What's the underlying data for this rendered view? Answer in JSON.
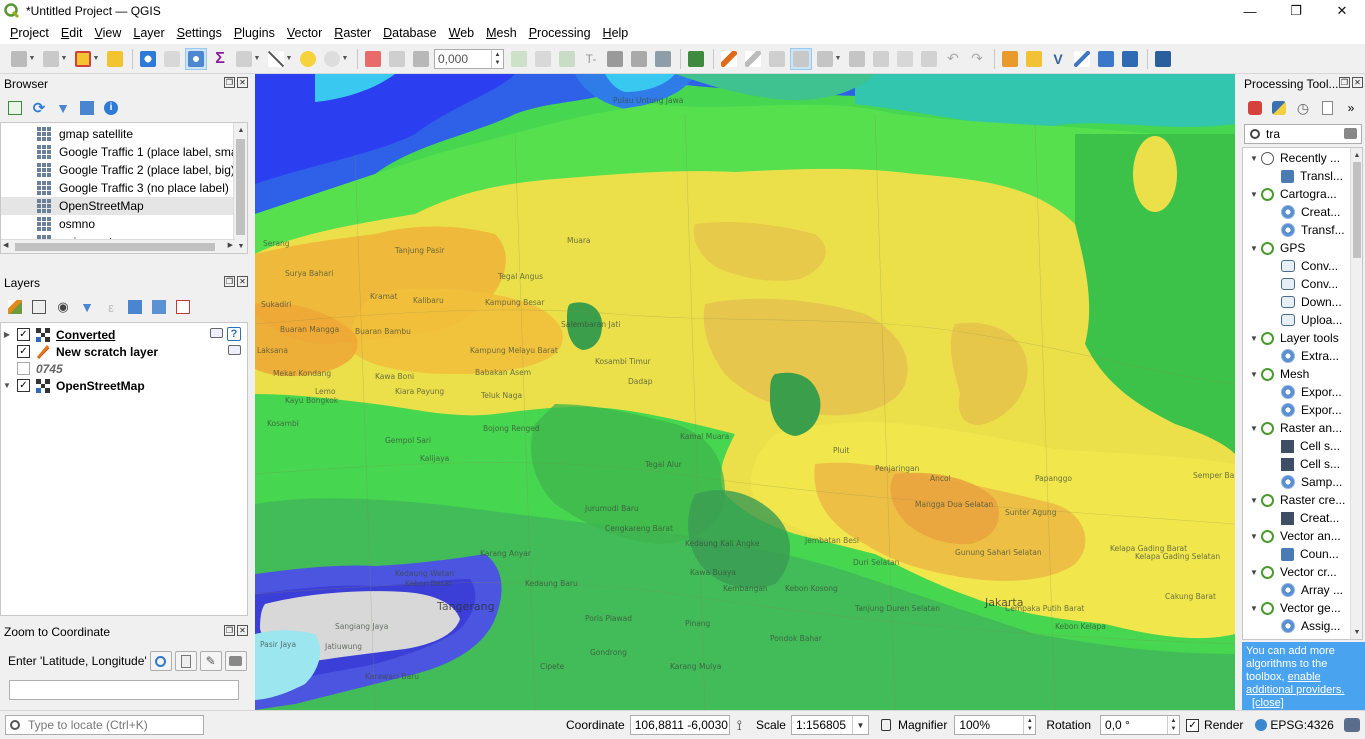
{
  "window": {
    "title": "*Untitled Project — QGIS",
    "minimize": "—",
    "restore": "❐",
    "close": "✕"
  },
  "menu": [
    "Project",
    "Edit",
    "View",
    "Layer",
    "Settings",
    "Plugins",
    "Vector",
    "Raster",
    "Database",
    "Web",
    "Mesh",
    "Processing",
    "Help"
  ],
  "toolbar": {
    "rotation_value": "0,000"
  },
  "browser": {
    "title": "Browser",
    "items": [
      {
        "label": "gmap satellite",
        "selected": false
      },
      {
        "label": "Google Traffic 1 (place label, smal",
        "selected": false
      },
      {
        "label": "Google Traffic 2 (place label, big)",
        "selected": false
      },
      {
        "label": "Google Traffic 3 (no place label)",
        "selected": false
      },
      {
        "label": "OpenStreetMap",
        "selected": true
      },
      {
        "label": "osmno",
        "selected": false
      },
      {
        "label": "swiss-carto",
        "selected": false
      }
    ]
  },
  "layers": {
    "title": "Layers",
    "items": [
      {
        "label": "Converted",
        "checked": true,
        "expanded": false
      },
      {
        "label": "New scratch layer",
        "checked": true,
        "expanded": false
      },
      {
        "label": "0745",
        "checked": false,
        "expanded": false
      },
      {
        "label": "OpenStreetMap",
        "checked": true,
        "expanded": true
      }
    ]
  },
  "zoom": {
    "title": "Zoom to Coordinate",
    "label": "Enter 'Latitude, Longitude'",
    "value": ""
  },
  "processing": {
    "title": "Processing Tool...",
    "search_value": "tra",
    "tree": [
      {
        "level": 0,
        "icon": "clock-icon",
        "label": "Recently ..."
      },
      {
        "level": 1,
        "icon": "script-icon",
        "label": "Transl..."
      },
      {
        "level": 0,
        "icon": "qgis-icon",
        "label": "Cartogra..."
      },
      {
        "level": 1,
        "icon": "gear-icon",
        "label": "Creat..."
      },
      {
        "level": 1,
        "icon": "gear-icon",
        "label": "Transf..."
      },
      {
        "level": 0,
        "icon": "qgis-icon",
        "label": "GPS"
      },
      {
        "level": 1,
        "icon": "convert-icon",
        "label": "Conv..."
      },
      {
        "level": 1,
        "icon": "convert-icon",
        "label": "Conv..."
      },
      {
        "level": 1,
        "icon": "convert-icon",
        "label": "Down..."
      },
      {
        "level": 1,
        "icon": "convert-icon",
        "label": "Uploa..."
      },
      {
        "level": 0,
        "icon": "qgis-icon",
        "label": "Layer tools"
      },
      {
        "level": 1,
        "icon": "gear-icon",
        "label": "Extra..."
      },
      {
        "level": 0,
        "icon": "qgis-icon",
        "label": "Mesh"
      },
      {
        "level": 1,
        "icon": "gear-icon",
        "label": "Expor..."
      },
      {
        "level": 1,
        "icon": "gear-icon",
        "label": "Expor..."
      },
      {
        "level": 0,
        "icon": "qgis-icon",
        "label": "Raster an..."
      },
      {
        "level": 1,
        "icon": "raster-icon",
        "label": "Cell s..."
      },
      {
        "level": 1,
        "icon": "raster-icon",
        "label": "Cell s..."
      },
      {
        "level": 1,
        "icon": "gear-icon",
        "label": "Samp..."
      },
      {
        "level": 0,
        "icon": "qgis-icon",
        "label": "Raster cre..."
      },
      {
        "level": 1,
        "icon": "grid-icon",
        "label": "Creat..."
      },
      {
        "level": 0,
        "icon": "qgis-icon",
        "label": "Vector an..."
      },
      {
        "level": 1,
        "icon": "count-icon",
        "label": "Coun..."
      },
      {
        "level": 0,
        "icon": "qgis-icon",
        "label": "Vector cr..."
      },
      {
        "level": 1,
        "icon": "gear-icon",
        "label": "Array ..."
      },
      {
        "level": 0,
        "icon": "qgis-icon",
        "label": "Vector ge..."
      },
      {
        "level": 1,
        "icon": "gear-icon",
        "label": "Assig..."
      }
    ],
    "info": {
      "text": "You can add more algorithms to the toolbox,",
      "link1": "enable additional providers.",
      "link2": "[close]"
    }
  },
  "map": {
    "labels": [
      "Serang",
      "Surya Bahari",
      "Tanjung Pasir",
      "Tegal Angus",
      "Muara",
      "Pulau Untung Jawa",
      "Sukadiri",
      "Kramat",
      "Kalibaru",
      "Kampung Besar",
      "Salembaran Jati",
      "Buaran Mangga",
      "Buaran Bambu",
      "Laksana",
      "Kampung Melayu Barat",
      "Kosambi Timur",
      "Mekar Kondang",
      "Kawa Boni",
      "Babakan Asem",
      "Dadap",
      "Kiara Payung",
      "Lemo",
      "Teluk Naga",
      "Kayu Bongkok",
      "Bojong Renged",
      "Kosambi",
      "Gempol Sari",
      "Kamal Muara",
      "Pluit",
      "Tegal Alur",
      "Penjaringan",
      "Ancol",
      "Papanggo",
      "Semper Barat",
      "Kedaung Kali Angke",
      "Jembatan Besi",
      "Mangga Dua Selatan",
      "Sunter Agung",
      "Kelapa Gading Barat",
      "Kawa Buaya",
      "Kedaung Wetan",
      "Kebon Besar",
      "Kembangan",
      "Duri Selatan",
      "Gunung Sahari Selatan",
      "Jakarta",
      "Tangerang",
      "Sangiang Jaya",
      "Pasir Jaya",
      "Jatiuwung",
      "Karawaci Baru",
      "Cipete",
      "Gondrong",
      "Karang Mulya",
      "Kelapa Gading Selatan",
      "Cakung Barat",
      "Kebon Kosong",
      "Tanjung Duren Selatan",
      "Cempaka Putih Barat",
      "Kebon Kelapa",
      "Pondok Bahar",
      "Cengkareng Barat",
      "Kalijaya",
      "Jurumudi Baru",
      "Karang Anyar",
      "Kedaung Baru",
      "Pinang",
      "Poris Plawad"
    ]
  },
  "status": {
    "coordinate_label": "Coordinate",
    "coordinate_value": "106,8811 -6,0030",
    "scale_label": "Scale",
    "scale_value": "1:156805",
    "magnifier_label": "Magnifier",
    "magnifier_value": "100%",
    "rotation_label": "Rotation",
    "rotation_value": "0,0 °",
    "render_label": "Render",
    "render_checked": true,
    "crs": "EPSG:4326",
    "locator_placeholder": "Type to locate (Ctrl+K)"
  }
}
